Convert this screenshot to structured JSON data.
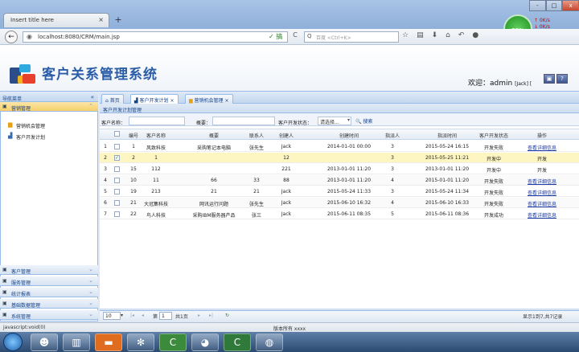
{
  "browser": {
    "tab_title": "Insert title here",
    "tab_close": "×",
    "new_tab": "+",
    "url": "localhost:8080/CRM/main.jsp",
    "search_placeholder": "百度 <Ctrl+K>",
    "speed_badge": "58%",
    "net_up": "↑ 0K/s",
    "net_down": "↓ 0K/s",
    "win_min": "-",
    "win_max": "□",
    "win_close": "x",
    "back_label": "←",
    "reload_label": "C",
    "shield_label": "✓ 搞",
    "search_icon": "Q"
  },
  "header": {
    "app_title": "客户关系管理系统",
    "welcome": "欢迎：admin",
    "welcome_suffix": "[Jack] [",
    "btn1": "▣",
    "btn2": "?"
  },
  "sidebar": {
    "title": "导航菜单",
    "collapse": "«",
    "sections": [
      {
        "label": "营销管理",
        "selected": true,
        "icon": "folder-icon",
        "chevron": "⌃"
      },
      {
        "label": "客户管理",
        "selected": false,
        "icon": "folder-icon",
        "chevron": "⌄"
      },
      {
        "label": "服务管理",
        "selected": false,
        "icon": "doc-icon",
        "chevron": "⌄"
      },
      {
        "label": "统计报表",
        "selected": false,
        "icon": "chart-icon",
        "chevron": "⌄"
      },
      {
        "label": "基础数据管理",
        "selected": false,
        "icon": "grid-icon",
        "chevron": "⌄"
      },
      {
        "label": "系统管理",
        "selected": false,
        "icon": "gear-icon",
        "chevron": "⌄"
      }
    ],
    "sub_items": [
      "营销机会管理",
      "客户开发计划"
    ]
  },
  "tabs": [
    "首页",
    "客户开发计划",
    "营销机会管理"
  ],
  "tab_close": "×",
  "panel_title": "客户开发计划管理",
  "filter": {
    "customer_label": "客户名称：",
    "summary_label": "概要：",
    "status_label": "客户开发状态：",
    "status_value": "请选择...",
    "status_arrow": "▾",
    "search_button": "搜索",
    "search_icon": "🔍"
  },
  "grid": {
    "columns": [
      "编号",
      "客户名称",
      "概要",
      "联系人",
      "创建人",
      "创建时间",
      "指派人",
      "指派时间",
      "客户开发状态",
      "操作"
    ],
    "rows": [
      {
        "n": "1",
        "id": "1",
        "cust": "风致科技",
        "sum": "采购笔记本电脑",
        "contact": "张先生",
        "creator": "Jack",
        "ctime": "2014-01-01 00:00",
        "assign": "3",
        "atime": "2015-05-24 16:15",
        "status": "开发失败",
        "op": "查看详细信息",
        "checked": false,
        "selected": false
      },
      {
        "n": "2",
        "id": "2",
        "cust": "1",
        "sum": "",
        "contact": "",
        "creator": "12",
        "ctime": "",
        "assign": "3",
        "atime": "2015-05-25 11:21",
        "status": "开发中",
        "op": "开发",
        "checked": true,
        "selected": true
      },
      {
        "n": "3",
        "id": "15",
        "cust": "112",
        "sum": "",
        "contact": "",
        "creator": "221",
        "ctime": "2013-01-01 11:20",
        "assign": "3",
        "atime": "2013-01-01 11:20",
        "status": "开发中",
        "op": "开发",
        "checked": false,
        "selected": false
      },
      {
        "n": "4",
        "id": "10",
        "cust": "11",
        "sum": "66",
        "contact": "33",
        "creator": "88",
        "ctime": "2013-01-01 11:20",
        "assign": "4",
        "atime": "2015-01-01 11:20",
        "status": "开发失败",
        "op": "查看详细信息",
        "checked": false,
        "selected": false
      },
      {
        "n": "5",
        "id": "19",
        "cust": "213",
        "sum": "21",
        "contact": "21",
        "creator": "Jack",
        "ctime": "2015-05-24 11:33",
        "assign": "3",
        "atime": "2015-05-24 11:34",
        "status": "开发失败",
        "op": "查看详细信息",
        "checked": false,
        "selected": false
      },
      {
        "n": "6",
        "id": "21",
        "cust": "大冠集科技",
        "sum": "网讯运行问题",
        "contact": "张先生",
        "creator": "Jack",
        "ctime": "2015-06-10 16:32",
        "assign": "4",
        "atime": "2015-06-10 16:33",
        "status": "开发失败",
        "op": "查看详细信息",
        "checked": false,
        "selected": false
      },
      {
        "n": "7",
        "id": "22",
        "cust": "鸟人科技",
        "sum": "采购IBM服务器产品",
        "contact": "张三",
        "creator": "Jack",
        "ctime": "2015-06-11 08:35",
        "assign": "5",
        "atime": "2015-06-11 08:36",
        "status": "开发成功",
        "op": "查看详细信息",
        "checked": false,
        "selected": false
      }
    ]
  },
  "pager": {
    "page_size": "10",
    "page_label": "第",
    "page_num": "1",
    "total_pages": "共1页",
    "summary": "显示1到7,共7记录",
    "first": "|◂",
    "prev": "◂",
    "next": "▸",
    "last": "▸|",
    "refresh": "↻"
  },
  "status_text": "javascript:void(0)",
  "footer": "版本所有 xxxx"
}
